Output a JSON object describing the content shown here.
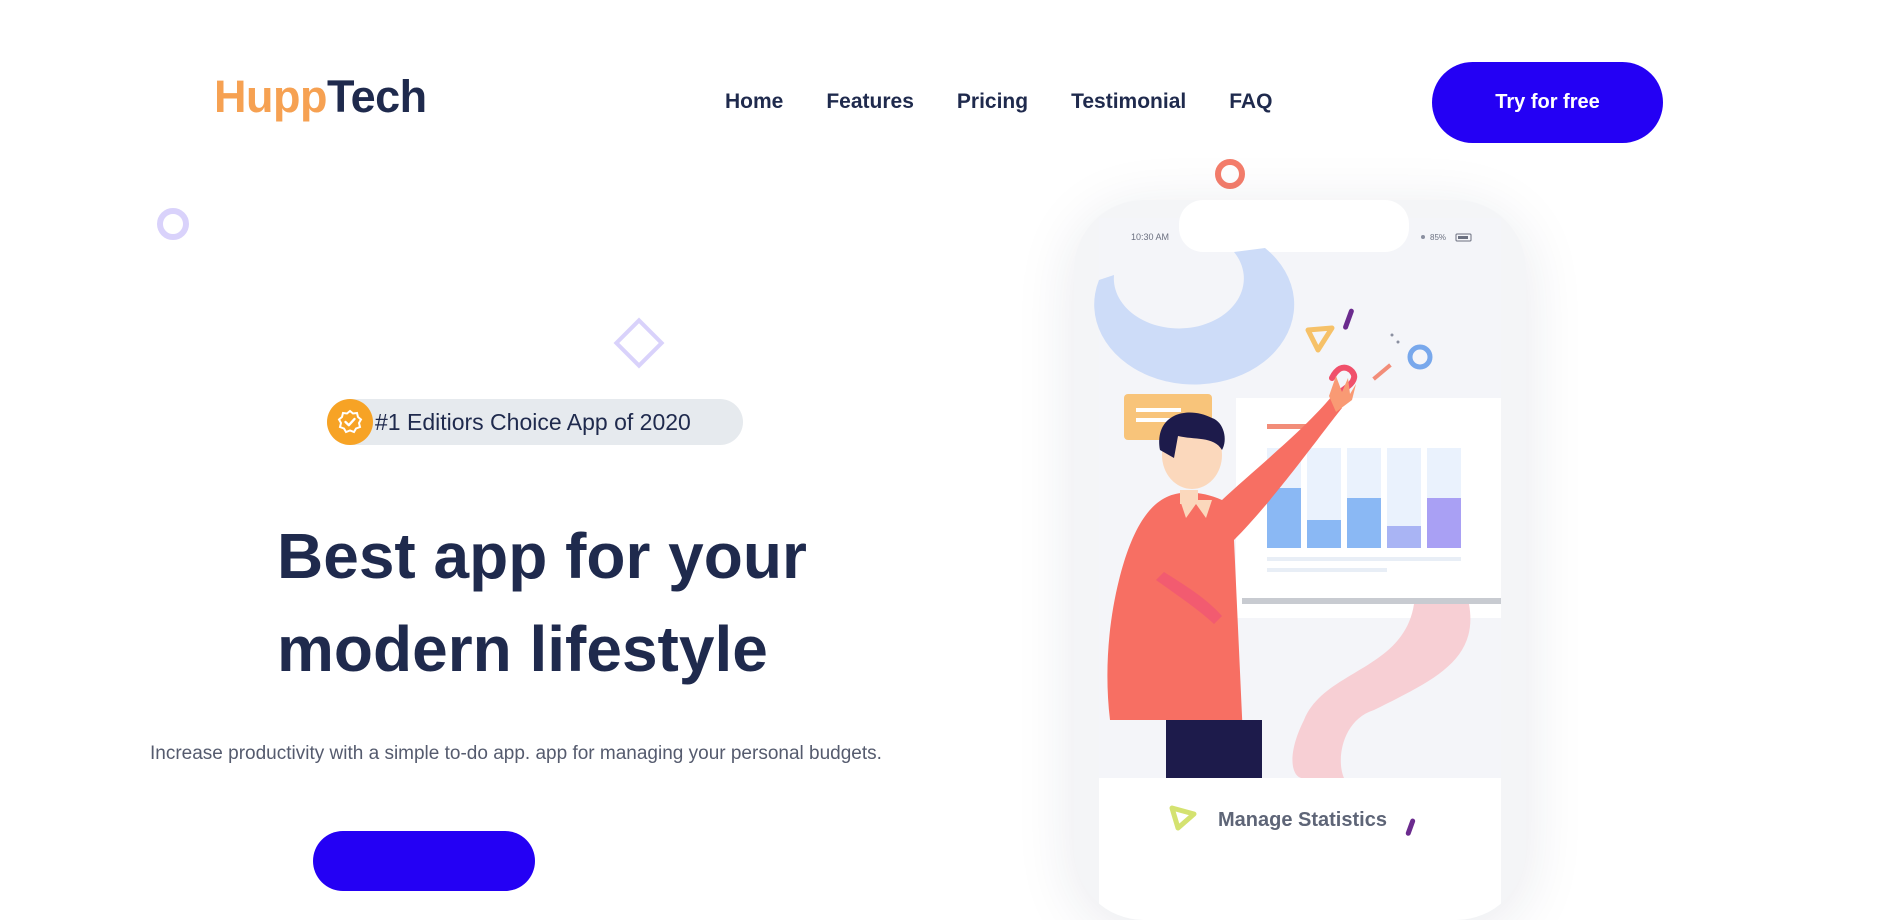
{
  "header": {
    "logo": {
      "part1": "Hupp",
      "part2": "Tech",
      "color1": "#f6a152",
      "color2": "#1f2a4d"
    },
    "nav": [
      {
        "label": "Home"
      },
      {
        "label": "Features"
      },
      {
        "label": "Pricing"
      },
      {
        "label": "Testimonial"
      },
      {
        "label": "FAQ"
      }
    ],
    "cta_label": "Try for free"
  },
  "hero": {
    "badge_text": "#1 Editiors Choice App of 2020",
    "badge_icon": "check-badge-icon",
    "title_line1": "Best app for your",
    "title_line2": "modern lifestyle",
    "subtitle": "Increase productivity with a simple to-do app. app for managing your personal budgets."
  },
  "phone": {
    "status_time": "10:30 AM",
    "battery": "85%",
    "card_title": "Manage Statistics",
    "illustration": "person-presenting-bar-chart"
  },
  "colors": {
    "accent": "#2400f4",
    "text_dark": "#1f2a4d",
    "badge_bg": "#e6eaee",
    "badge_icon_bg": "#f7a325"
  }
}
